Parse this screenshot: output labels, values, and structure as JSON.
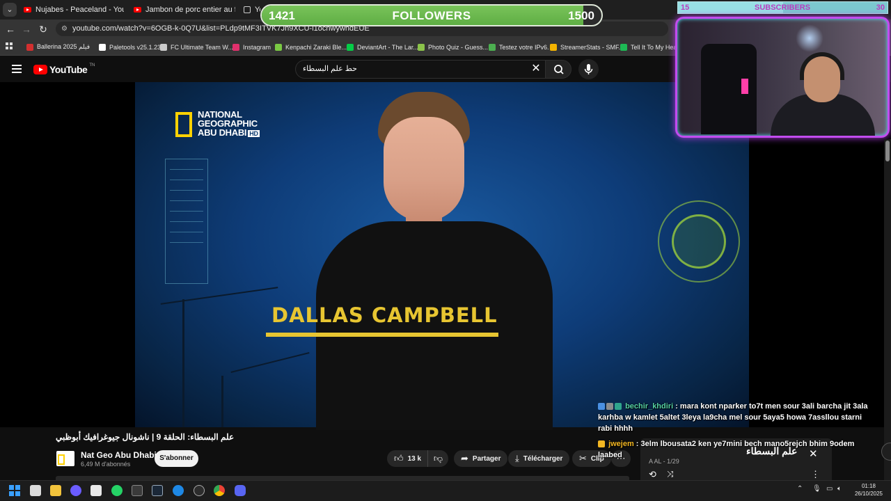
{
  "browser": {
    "tabs": [
      {
        "label": "Nujabes - Peaceland - YouTube"
      },
      {
        "label": "Jambon de porc entier au four|"
      },
      {
        "label": "You"
      }
    ],
    "url": "youtube.com/watch?v=6OGB-k-0Q7U&list=PLdp9tMF3ITVK7Jn9XCU-l1ochwywhdEUE",
    "bookmarks": [
      {
        "label": "Ballerina 2025 فيلم",
        "color": "#d32f2f"
      },
      {
        "label": "Paletools v25.1.23",
        "color": "#ffffff"
      },
      {
        "label": "FC Ultimate Team W...",
        "color": "#cccccc"
      },
      {
        "label": "Instagram",
        "color": "#e1306c"
      },
      {
        "label": "Kenpachi Zaraki Ble...",
        "color": "#7ac943"
      },
      {
        "label": "DeviantArt - The Lar...",
        "color": "#05cc47"
      },
      {
        "label": "Photo Quiz - Guess...",
        "color": "#8bc34a"
      },
      {
        "label": "Testez votre IPv6.",
        "color": "#4caf50"
      },
      {
        "label": "StreamerStats - SMF...",
        "color": "#f4b400"
      },
      {
        "label": "Tell It To My Heart",
        "color": "#1db954"
      }
    ]
  },
  "youtube": {
    "logo_word": "YouTube",
    "logo_sup": "TN",
    "search_value": "حط علم البسطاء",
    "video": {
      "logo_line1": "NATIONAL",
      "logo_line2": "GEOGRAPHIC",
      "logo_line3": "ABU DHABI",
      "logo_hd": "HD",
      "lower_third": "DALLAS CAMPBELL"
    },
    "title": "علم البسطاء: الحلقة 9 | ناشونال جيوغرافيك أبوظبي",
    "channel": {
      "name": "Nat Geo Abu Dhabi",
      "subscribers": "6,49 M d'abonnés",
      "subscribe_label": "S'abonner"
    },
    "actions": {
      "likes": "13 k",
      "share": "Partager",
      "download": "Télécharger",
      "clip": "Clip"
    },
    "playlist": {
      "title": "علم البسطاء",
      "position": "A AL - 1/29"
    }
  },
  "overlay": {
    "followers": {
      "current": 1421,
      "label": "FOLLOWERS",
      "goal": 1500
    },
    "subscribers": {
      "current": 15,
      "label": "SUBSCRIBERS",
      "goal": 30
    },
    "chat": [
      {
        "user": "bechir_khdiri",
        "message": " : mara kont nparker to7t men sour 3ali barcha jit 3ala karhba w kamlet 5altet 3leya la9cha mel sour 5aya5 howa 7assllou starni rabi hhhh"
      },
      {
        "user": "jwejem",
        "message": " : 3elm lbousata2 ken ye7mini bech mano5rejch bhim 9odem laabed"
      }
    ]
  },
  "taskbar": {
    "time": "01:18",
    "date": "26/10/2025"
  },
  "colors": {
    "accent_youtube": "#ff0000",
    "followers_fill": "#6ab94d",
    "webcam_border": "#c34cf0",
    "natgeo_yellow": "#ffd200"
  }
}
